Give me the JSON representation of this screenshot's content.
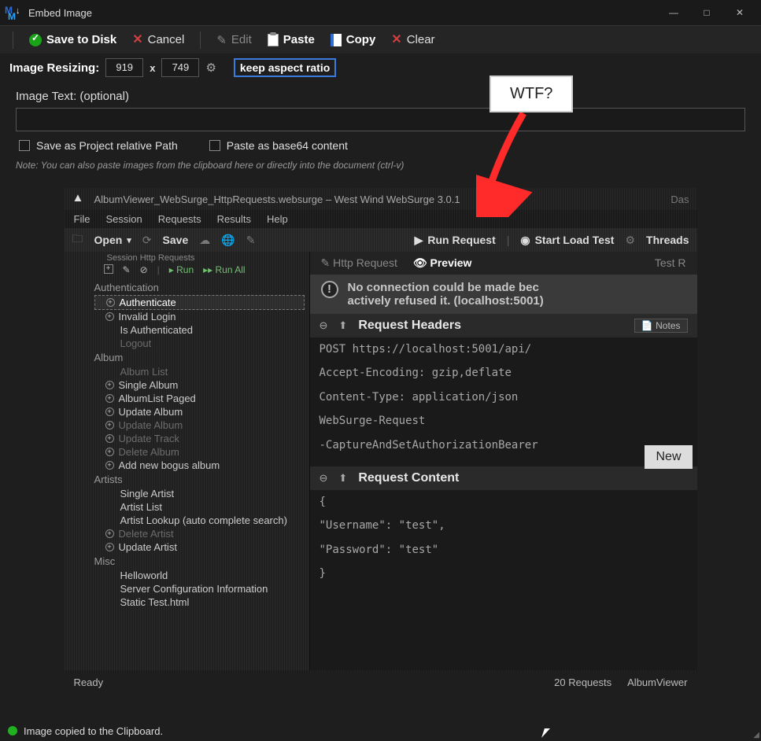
{
  "window": {
    "title": "Embed Image",
    "controls": {
      "min": "—",
      "max": "□",
      "close": "✕"
    }
  },
  "toolbar": {
    "save": "Save to Disk",
    "cancel": "Cancel",
    "edit": "Edit",
    "paste": "Paste",
    "copy": "Copy",
    "clear": "Clear"
  },
  "resize": {
    "label": "Image Resizing:",
    "w": "919",
    "x": "x",
    "h": "749",
    "keep": "keep aspect ratio"
  },
  "imagetext": {
    "label": "Image Text: (optional)",
    "value": ""
  },
  "checks": {
    "relativePath": "Save as Project relative Path",
    "base64": "Paste as base64 content"
  },
  "hint": "Note: You can also paste images from the clipboard here or directly into the document (ctrl-v)",
  "callout": "WTF?",
  "preview": {
    "title": "AlbumViewer_WebSurge_HttpRequests.websurge – West Wind WebSurge 3.0.1",
    "rightword": "Das",
    "menu": [
      "File",
      "Session",
      "Requests",
      "Results",
      "Help"
    ],
    "buttons": {
      "open": "Open",
      "save": "Save",
      "run": "Run Request",
      "start": "Start Load Test",
      "threads": "Threads"
    },
    "leftbar": {
      "headline": "Session Http Requests",
      "run": "Run",
      "runall": "Run All"
    },
    "tree": {
      "g1": "Authentication",
      "g1items": [
        {
          "t": "Authenticate",
          "sel": true,
          "plus": true
        },
        {
          "t": "Invalid Login",
          "plus": true
        },
        {
          "t": "Is Authenticated"
        },
        {
          "t": "Logout",
          "dim": true
        }
      ],
      "g2": "Album",
      "g2items": [
        {
          "t": "Album List",
          "dim": true
        },
        {
          "t": "Single Album",
          "plus": true
        },
        {
          "t": "AlbumList Paged",
          "plus": true
        },
        {
          "t": "Update Album",
          "plus": true
        },
        {
          "t": "Update Album",
          "dim": true,
          "plus": true
        },
        {
          "t": "Update Track",
          "dim": true,
          "plus": true
        },
        {
          "t": "Delete Album",
          "dim": true,
          "plus": true
        },
        {
          "t": "Add new bogus album",
          "plus": true
        }
      ],
      "g3": "Artists",
      "g3items": [
        {
          "t": "Single Artist"
        },
        {
          "t": "Artist List"
        },
        {
          "t": "Artist Lookup (auto complete search)"
        },
        {
          "t": "Delete Artist",
          "dim": true,
          "plus": true
        },
        {
          "t": "Update Artist",
          "plus": true
        }
      ],
      "g4": "Misc",
      "g4items": [
        {
          "t": "Helloworld"
        },
        {
          "t": "Server Configuration Information"
        },
        {
          "t": "Static Test.html"
        }
      ]
    },
    "right": {
      "tabs": {
        "http": "Http Request",
        "preview": "Preview",
        "test": "Test R"
      },
      "errorLine1": "No connection could be made bec",
      "errorLine2": "actively refused it. (localhost:5001)",
      "reqHeaders": "Request Headers",
      "notes": "Notes",
      "newbtn": "New",
      "post": "POST https://localhost:5001/api/",
      "h1": "Accept-Encoding: gzip,deflate",
      "h2": "Content-Type: application/json",
      "h3": "WebSurge-Request",
      "h4": " -CaptureAndSetAuthorizationBearer",
      "reqContent": "Request Content",
      "body1": "{",
      "body2": "  \"Username\": \"test\",",
      "body3": "  \"Password\": \"test\"",
      "body4": "}"
    },
    "status": {
      "ready": "Ready",
      "count": "20 Requests",
      "proj": "AlbumViewer"
    }
  },
  "status": "Image copied to the Clipboard."
}
